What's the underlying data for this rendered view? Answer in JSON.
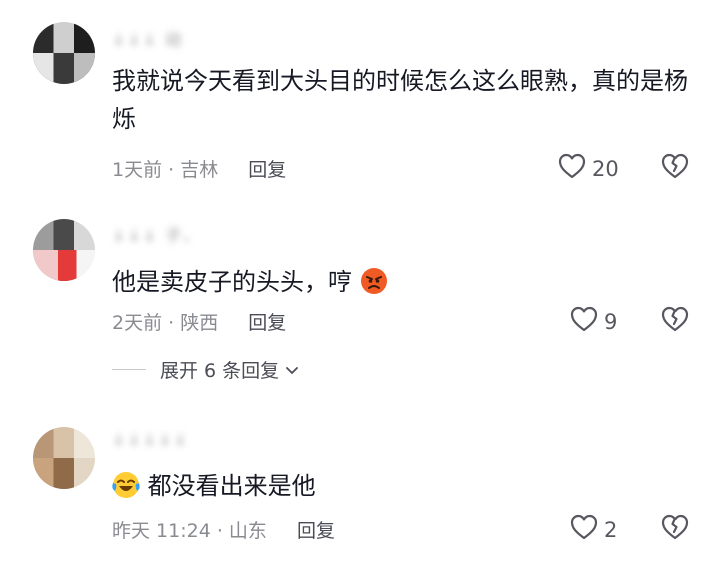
{
  "comments": [
    {
      "username": "↓↓↓ 动",
      "text": "我就说今天看到大头目的时候怎么这么眼熟，真的是杨烁",
      "time": "1天前",
      "location": "吉林",
      "reply_label": "回复",
      "likes": "20"
    },
    {
      "username": "↓↓↓ 子、",
      "text": "他是卖皮子的头头，哼",
      "time": "2天前",
      "location": "陕西",
      "reply_label": "回复",
      "likes": "9",
      "emoji": "angry-face-icon"
    },
    {
      "username": "↓↓↓↓↓",
      "text": "都没看出来是他",
      "time": "昨天 11:24",
      "location": "山东",
      "reply_label": "回复",
      "likes": "2",
      "emoji": "crying-laughing-icon"
    }
  ],
  "expand_replies": {
    "label": "展开 6 条回复"
  },
  "colors": {
    "text": "#161823",
    "meta": "#8a8b91",
    "icon": "#57585f"
  }
}
